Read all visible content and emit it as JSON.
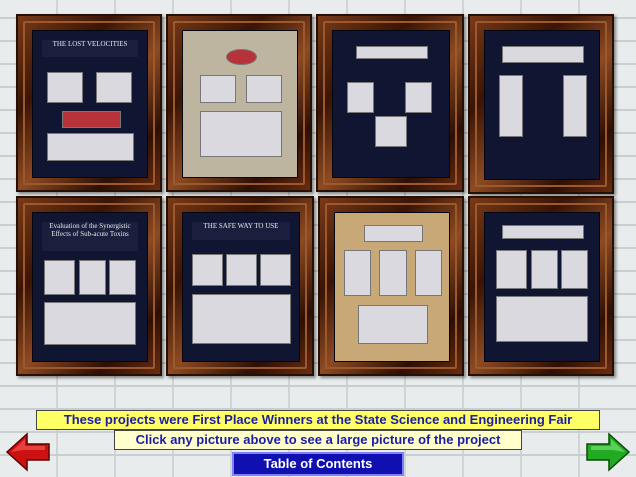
{
  "projects": [
    {
      "title": "THE LOST VELOCITIES"
    },
    {
      "title": ""
    },
    {
      "title": ""
    },
    {
      "title": ""
    },
    {
      "title": "Evaluation of the Synergistic Effects of Sub-acute Toxins"
    },
    {
      "title": "THE SAFE WAY TO USE"
    },
    {
      "title": ""
    },
    {
      "title": ""
    }
  ],
  "banner_winners": "These projects were First Place Winners at the State Science and Engineering Fair",
  "banner_instruction": "Click any picture above to see a large picture of the project",
  "toc_label": "Table of Contents",
  "nav": {
    "prev_icon": "left-arrow-icon",
    "next_icon": "right-arrow-icon"
  },
  "colors": {
    "prev_arrow": "#cc1111",
    "next_arrow": "#22aa22",
    "banner": "#ffff66",
    "toc": "#1010b0"
  }
}
